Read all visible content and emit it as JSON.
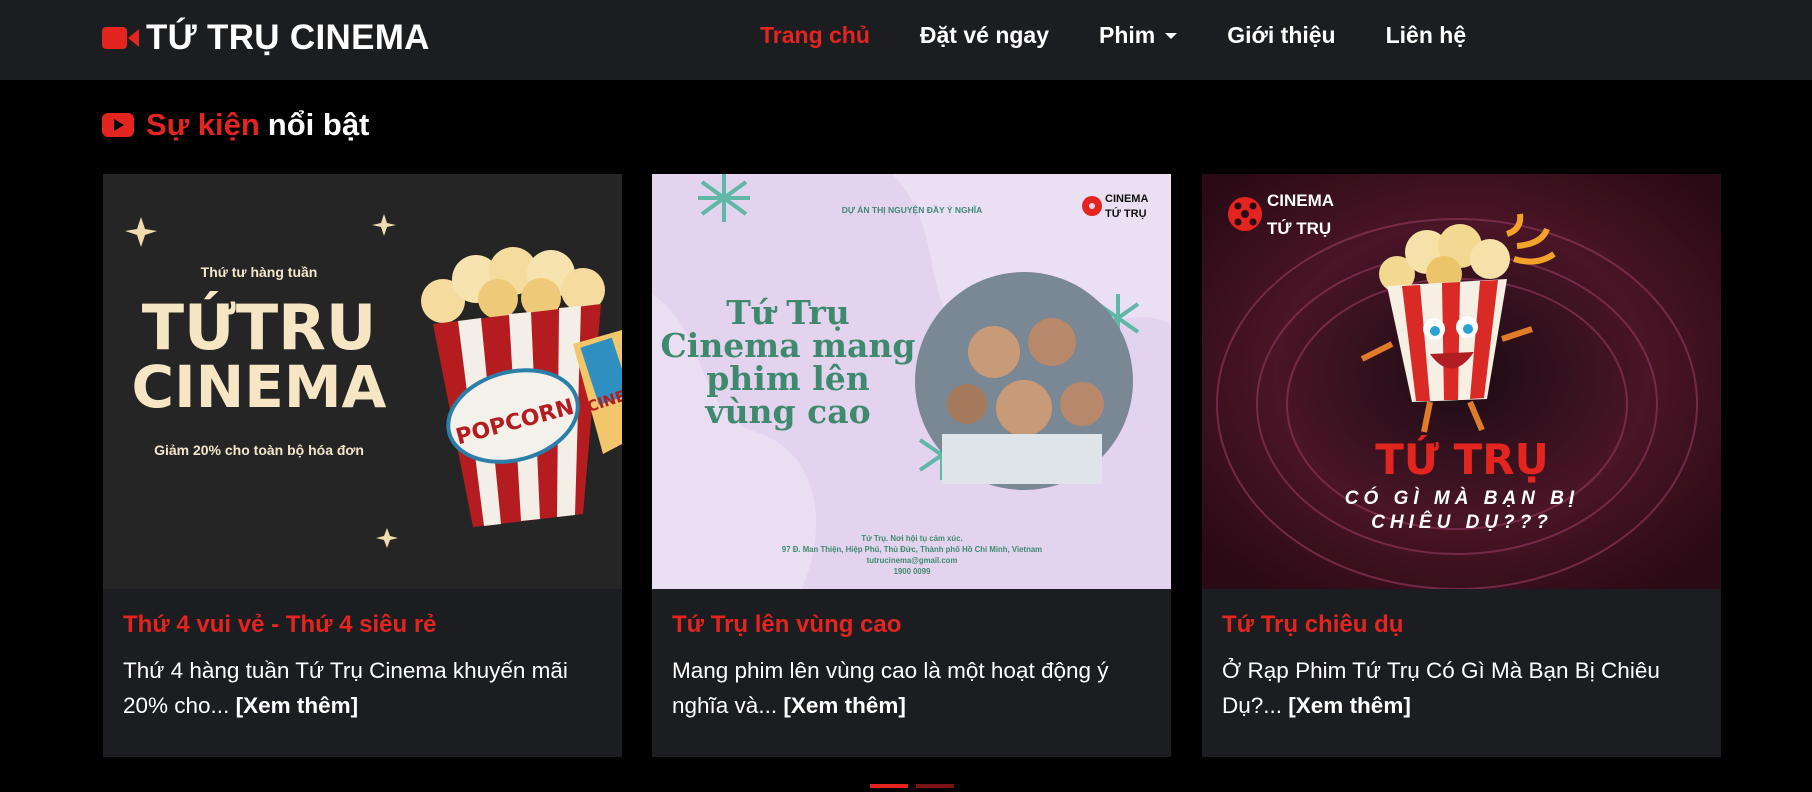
{
  "brand": {
    "name": "TỨ TRỤ CINEMA",
    "icon": "video-camera-icon",
    "accent": "#e3241f"
  },
  "nav": {
    "items": [
      {
        "label": "Trang chủ",
        "active": true
      },
      {
        "label": "Đặt vé ngay",
        "active": false
      },
      {
        "label": "Phim",
        "active": false,
        "dropdown": true
      },
      {
        "label": "Giới thiệu",
        "active": false
      },
      {
        "label": "Liên hệ",
        "active": false
      }
    ]
  },
  "section": {
    "icon": "youtube-play-icon",
    "title_accent": "Sự kiện",
    "title_rest": "nổi bật"
  },
  "cards": [
    {
      "title": "Thứ 4 vui vẻ - Thứ 4 siêu rẻ",
      "text": "Thứ 4 hàng tuần Tứ Trụ Cinema khuyến mãi 20% cho...",
      "more": "[Xem thêm]",
      "image": {
        "top": "Thứ tư hàng tuần",
        "line1": "TỨTRU",
        "line2": "CINEMA",
        "bottom": "Giảm 20% cho toàn bộ hóa đơn",
        "badge": "POPCORN",
        "ticket": "CINE"
      }
    },
    {
      "title": "Tứ Trụ lên vùng cao",
      "text": "Mang phim lên vùng cao là một hoạt động ý nghĩa và...",
      "more": "[Xem thêm]",
      "image": {
        "top": "DỰ ÁN THỊ NGUYỆN ĐẦY Ý NGHĨA",
        "logo1": "CINEMA",
        "logo2": "TỨ TRỤ",
        "h1": "Tứ Trụ",
        "h2": "Cinema mang",
        "h3": "phim lên",
        "h4": "vùng cao",
        "f1": "Tứ Trụ. Nơi hội tụ cảm xúc.",
        "f2": "97 Đ. Man Thiện, Hiệp Phú, Thủ Đức, Thành phố Hồ Chí Minh, Vietnam",
        "f3": "tutrucinema@gmail.com",
        "f4": "1900 0099"
      }
    },
    {
      "title": "Tứ Trụ chiêu dụ",
      "text": "Ở Rạp Phim Tứ Trụ Có Gì Mà Bạn Bị Chiêu Dụ?...",
      "more": "[Xem thêm]",
      "image": {
        "logo1": "CINEMA",
        "logo2": "TỨ TRỤ",
        "h1": "TỨ TRỤ",
        "h2": "CÓ GÌ MÀ BẠN BỊ",
        "h3": "CHIÊU DỤ???"
      }
    }
  ],
  "carousel": {
    "count": 2,
    "active": 0
  }
}
